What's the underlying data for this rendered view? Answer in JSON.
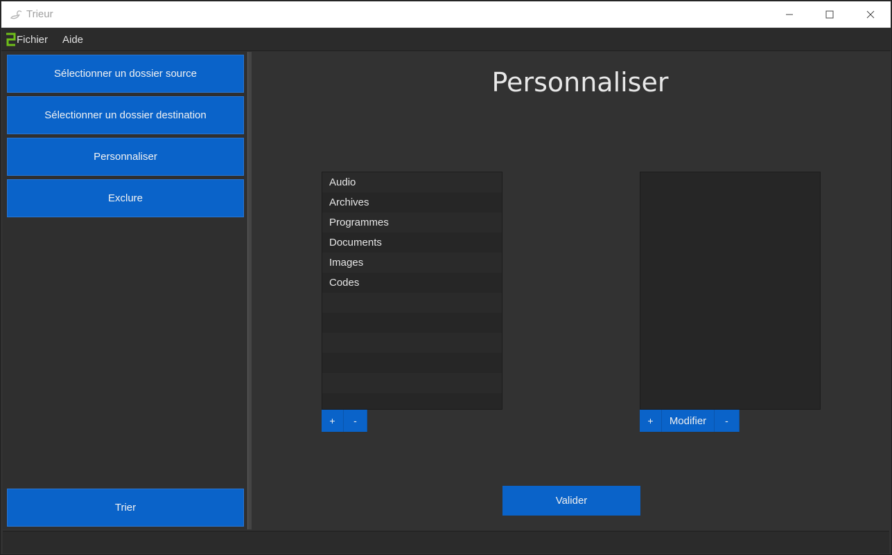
{
  "window": {
    "title": "Trieur",
    "minimize_icon": "minimize-icon",
    "maximize_icon": "maximize-icon",
    "close_icon": "close-icon"
  },
  "menu": {
    "items": [
      {
        "label": "Fichier"
      },
      {
        "label": "Aide"
      }
    ]
  },
  "sidebar": {
    "buttons": [
      {
        "label": "Sélectionner un dossier source"
      },
      {
        "label": "Sélectionner un dossier destination"
      },
      {
        "label": "Personnaliser"
      },
      {
        "label": "Exclure"
      }
    ],
    "sort_button": {
      "label": "Trier"
    }
  },
  "main": {
    "title": "Personnaliser",
    "categories": [
      "Audio",
      "Archives",
      "Programmes",
      "Documents",
      "Images",
      "Codes"
    ],
    "left_controls": {
      "add": "+",
      "remove": "-"
    },
    "right_controls": {
      "add": "+",
      "edit": "Modifier",
      "remove": "-"
    },
    "validate": "Valider"
  },
  "colors": {
    "accent": "#0a63c9",
    "background": "#323232",
    "list_background": "#262626",
    "logo": "#6fbf1a"
  }
}
